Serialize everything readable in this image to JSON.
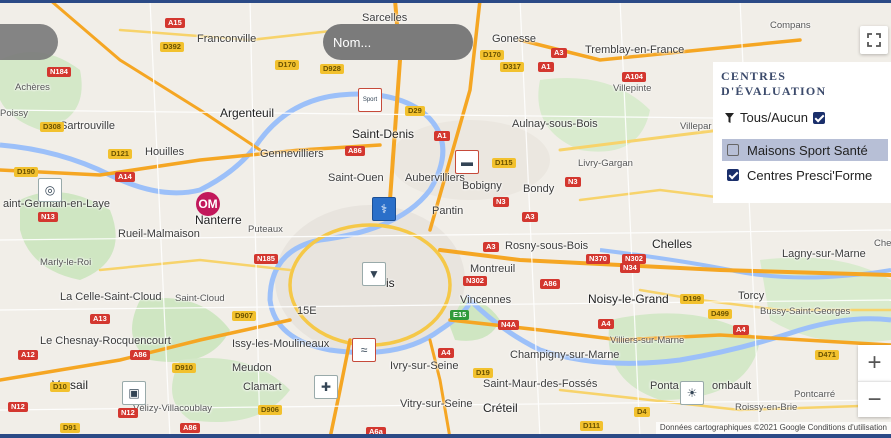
{
  "search": {
    "placeholder": "Nom..."
  },
  "panel": {
    "title": "CENTRES D'ÉVALUATION",
    "filter_label": "Tous/Aucun",
    "filter_checked": true,
    "categories": [
      {
        "label": "Maisons Sport Santé",
        "checked": false,
        "highlighted": true
      },
      {
        "label": "Centres Presci'Forme",
        "checked": true,
        "highlighted": false
      }
    ]
  },
  "zoom": {
    "in_label": "+",
    "out_label": "−"
  },
  "attribution": "Données cartographiques ©2021 Google   Conditions d'utilisation",
  "map": {
    "places": [
      {
        "name": "Sarcelles",
        "cls": "mid"
      },
      {
        "name": "Franconville",
        "cls": "mid"
      },
      {
        "name": "Gonesse",
        "cls": "mid"
      },
      {
        "name": "Tremblay-en-France",
        "cls": "mid"
      },
      {
        "name": "Compans",
        "cls": "small"
      },
      {
        "name": "Villepinte",
        "cls": "small"
      },
      {
        "name": "Achères",
        "cls": "small"
      },
      {
        "name": "Poissy",
        "cls": "small"
      },
      {
        "name": "Argenteuil",
        "cls": "major"
      },
      {
        "name": "Sartrouville",
        "cls": "mid"
      },
      {
        "name": "Houilles",
        "cls": "mid"
      },
      {
        "name": "Gennevilliers",
        "cls": "mid"
      },
      {
        "name": "Saint-Denis",
        "cls": "major"
      },
      {
        "name": "Aulnay-sous-Bois",
        "cls": "mid"
      },
      {
        "name": "Villepar",
        "cls": "small"
      },
      {
        "name": "Livry-Gargan",
        "cls": "small"
      },
      {
        "name": "Saint-Ouen",
        "cls": "mid"
      },
      {
        "name": "Aubervilliers",
        "cls": "mid"
      },
      {
        "name": "Bobigny",
        "cls": "mid"
      },
      {
        "name": "Bondy",
        "cls": "mid"
      },
      {
        "name": "aint-Germain-en-Laye",
        "cls": "mid"
      },
      {
        "name": "Nanterre",
        "cls": "major"
      },
      {
        "name": "Pantin",
        "cls": "mid"
      },
      {
        "name": "Rueil-Malmaison",
        "cls": "mid"
      },
      {
        "name": "Puteaux",
        "cls": "small"
      },
      {
        "name": "Rosny-sous-Bois",
        "cls": "mid"
      },
      {
        "name": "Chelles",
        "cls": "major"
      },
      {
        "name": "Lagny-sur-Marne",
        "cls": "mid"
      },
      {
        "name": "Marly-le-Roi",
        "cls": "small"
      },
      {
        "name": "Montreuil",
        "cls": "mid"
      },
      {
        "name": "La Celle-Saint-Cloud",
        "cls": "mid"
      },
      {
        "name": "Saint-Cloud",
        "cls": "small"
      },
      {
        "name": "15E",
        "cls": "mid"
      },
      {
        "name": "Vincennes",
        "cls": "mid"
      },
      {
        "name": "Noisy-le-Grand",
        "cls": "major"
      },
      {
        "name": "Torcy",
        "cls": "mid"
      },
      {
        "name": "Bussy-Saint-Georges",
        "cls": "small"
      },
      {
        "name": "Le Chesnay-Rocquencourt",
        "cls": "mid"
      },
      {
        "name": "Issy-les-Moulineaux",
        "cls": "mid"
      },
      {
        "name": "Villiers-sur-Marne",
        "cls": "small"
      },
      {
        "name": "Champigny-sur-Marne",
        "cls": "mid"
      },
      {
        "name": "Meudon",
        "cls": "mid"
      },
      {
        "name": "Ivry-sur-Seine",
        "cls": "mid"
      },
      {
        "name": "Versail",
        "cls": "major"
      },
      {
        "name": "Clamart",
        "cls": "mid"
      },
      {
        "name": "Saint-Maur-des-Fossés",
        "cls": "mid"
      },
      {
        "name": "Ponta",
        "cls": "mid"
      },
      {
        "name": "ombault",
        "cls": "mid"
      },
      {
        "name": "Pontcarré",
        "cls": "small"
      },
      {
        "name": "Vélizy-Villacoublay",
        "cls": "small"
      },
      {
        "name": "Vitry-sur-Seine",
        "cls": "mid"
      },
      {
        "name": "Créteil",
        "cls": "major"
      },
      {
        "name": "Roissy-en-Brie",
        "cls": "small"
      },
      {
        "name": "Che",
        "cls": "small"
      },
      {
        "name": "is",
        "cls": "major"
      }
    ],
    "roads": [
      {
        "label": "A15",
        "cls": "red"
      },
      {
        "label": "D392",
        "cls": "yel"
      },
      {
        "label": "D170",
        "cls": "yel"
      },
      {
        "label": "D317",
        "cls": "yel"
      },
      {
        "label": "A1",
        "cls": "red"
      },
      {
        "label": "A3",
        "cls": "red"
      },
      {
        "label": "N184",
        "cls": "red"
      },
      {
        "label": "D170",
        "cls": "yel"
      },
      {
        "label": "D928",
        "cls": "yel"
      },
      {
        "label": "A104",
        "cls": "red"
      },
      {
        "label": "D29",
        "cls": "yel"
      },
      {
        "label": "D308",
        "cls": "yel"
      },
      {
        "label": "A1",
        "cls": "red"
      },
      {
        "label": "D121",
        "cls": "yel"
      },
      {
        "label": "A86",
        "cls": "red"
      },
      {
        "label": "D190",
        "cls": "yel"
      },
      {
        "label": "A14",
        "cls": "red"
      },
      {
        "label": "D115",
        "cls": "yel"
      },
      {
        "label": "N3",
        "cls": "red"
      },
      {
        "label": "N3",
        "cls": "red"
      },
      {
        "label": "N13",
        "cls": "red"
      },
      {
        "label": "A3",
        "cls": "red"
      },
      {
        "label": "N185",
        "cls": "red"
      },
      {
        "label": "A3",
        "cls": "red"
      },
      {
        "label": "N370",
        "cls": "red"
      },
      {
        "label": "N302",
        "cls": "red"
      },
      {
        "label": "N34",
        "cls": "red"
      },
      {
        "label": "N302",
        "cls": "red"
      },
      {
        "label": "A86",
        "cls": "red"
      },
      {
        "label": "D199",
        "cls": "yel"
      },
      {
        "label": "D499",
        "cls": "yel"
      },
      {
        "label": "A13",
        "cls": "red"
      },
      {
        "label": "D907",
        "cls": "yel"
      },
      {
        "label": "E15",
        "cls": "grn"
      },
      {
        "label": "N4A",
        "cls": "red"
      },
      {
        "label": "A4",
        "cls": "red"
      },
      {
        "label": "A4",
        "cls": "red"
      },
      {
        "label": "A12",
        "cls": "red"
      },
      {
        "label": "A86",
        "cls": "red"
      },
      {
        "label": "D910",
        "cls": "yel"
      },
      {
        "label": "A4",
        "cls": "red"
      },
      {
        "label": "D471",
        "cls": "yel"
      },
      {
        "label": "D10",
        "cls": "yel"
      },
      {
        "label": "D19",
        "cls": "yel"
      },
      {
        "label": "N12",
        "cls": "red"
      },
      {
        "label": "D906",
        "cls": "yel"
      },
      {
        "label": "N12",
        "cls": "red"
      },
      {
        "label": "A86",
        "cls": "red"
      },
      {
        "label": "D91",
        "cls": "yel"
      },
      {
        "label": "D111",
        "cls": "yel"
      },
      {
        "label": "D4",
        "cls": "yel"
      },
      {
        "label": "A6a",
        "cls": "red"
      }
    ],
    "markers": [
      {
        "name": "marker-sport-sante-saint-denis",
        "kind": "square",
        "glyph": "Sport"
      },
      {
        "name": "marker-presciforme-aubervilliers",
        "kind": "square",
        "glyph": "▬"
      },
      {
        "name": "marker-st-germain",
        "kind": "plain",
        "glyph": "◎"
      },
      {
        "name": "marker-nanterre",
        "kind": "circle",
        "glyph": "OM"
      },
      {
        "name": "marker-paris-doctor",
        "kind": "blue",
        "glyph": "⚕"
      },
      {
        "name": "marker-paris-center",
        "kind": "plain",
        "glyph": "▼"
      },
      {
        "name": "marker-issy",
        "kind": "square",
        "glyph": "≈"
      },
      {
        "name": "marker-versailles",
        "kind": "plain",
        "glyph": "▣"
      },
      {
        "name": "marker-clamart",
        "kind": "plain",
        "glyph": "✚"
      },
      {
        "name": "marker-pontault",
        "kind": "plain",
        "glyph": "☀"
      }
    ]
  }
}
